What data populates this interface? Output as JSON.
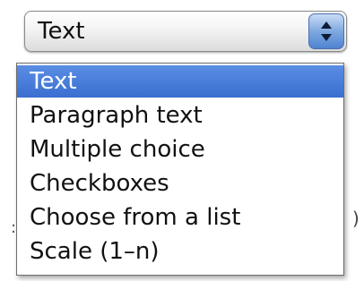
{
  "select": {
    "value": "Text"
  },
  "dropdown": {
    "options": [
      {
        "label": "Text",
        "selected": true
      },
      {
        "label": "Paragraph text",
        "selected": false
      },
      {
        "label": "Multiple choice",
        "selected": false
      },
      {
        "label": "Checkboxes",
        "selected": false
      },
      {
        "label": "Choose from a list",
        "selected": false
      },
      {
        "label": "Scale (1–n)",
        "selected": false
      }
    ]
  },
  "colors": {
    "selection": "#3f74d6",
    "selection_text": "#ffffff"
  },
  "icons": {
    "select_arrows": "up-down-chevron-icon"
  }
}
